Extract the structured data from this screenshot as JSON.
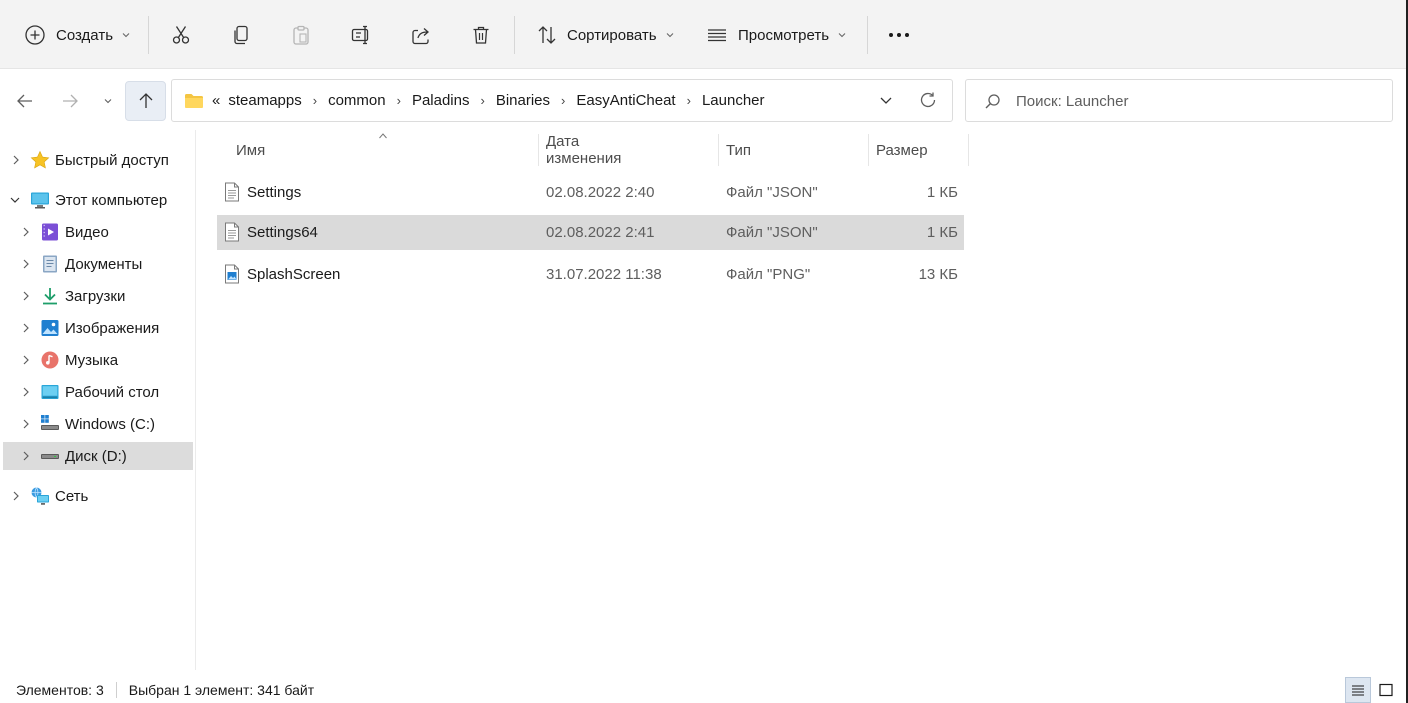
{
  "toolbar": {
    "create_label": "Создать",
    "sort_label": "Сортировать",
    "view_label": "Просмотреть"
  },
  "address": {
    "overflow": "«",
    "crumbs": [
      "steamapps",
      "common",
      "Paladins",
      "Binaries",
      "EasyAntiCheat",
      "Launcher"
    ]
  },
  "search": {
    "placeholder": "Поиск: Launcher"
  },
  "nav": {
    "quick_access": "Быстрый доступ",
    "this_pc": "Этот компьютер",
    "video": "Видео",
    "documents": "Документы",
    "downloads": "Загрузки",
    "pictures": "Изображения",
    "music": "Музыка",
    "desktop": "Рабочий стол",
    "drive_c": "Windows (C:)",
    "drive_d": "Диск (D:)",
    "network": "Сеть"
  },
  "columns": {
    "name": "Имя",
    "date": "Дата изменения",
    "type": "Тип",
    "size": "Размер"
  },
  "files": [
    {
      "name": "Settings",
      "date": "02.08.2022 2:40",
      "type": "Файл \"JSON\"",
      "size": "1 КБ",
      "icon": "json-file-icon"
    },
    {
      "name": "Settings64",
      "date": "02.08.2022 2:41",
      "type": "Файл \"JSON\"",
      "size": "1 КБ",
      "icon": "json-file-icon",
      "selected": true
    },
    {
      "name": "SplashScreen",
      "date": "31.07.2022 11:38",
      "type": "Файл \"PNG\"",
      "size": "13 КБ",
      "icon": "png-file-icon"
    }
  ],
  "status": {
    "count": "Элементов: 3",
    "selection": "Выбран 1 элемент: 341 байт"
  },
  "colors": {
    "selection": "#dadada",
    "accent": "#0067c0",
    "folder": "#f4c542"
  }
}
